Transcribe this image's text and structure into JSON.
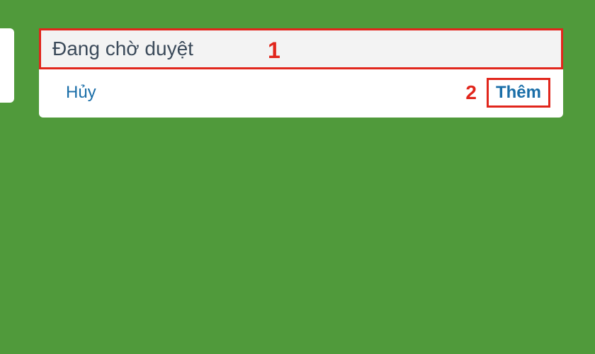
{
  "card": {
    "input": {
      "value": "Đang chờ duyệt",
      "placeholder": ""
    },
    "actions": {
      "cancel_label": "Hủy",
      "add_label": "Thêm"
    }
  },
  "annotations": {
    "step1": "1",
    "step2": "2"
  }
}
